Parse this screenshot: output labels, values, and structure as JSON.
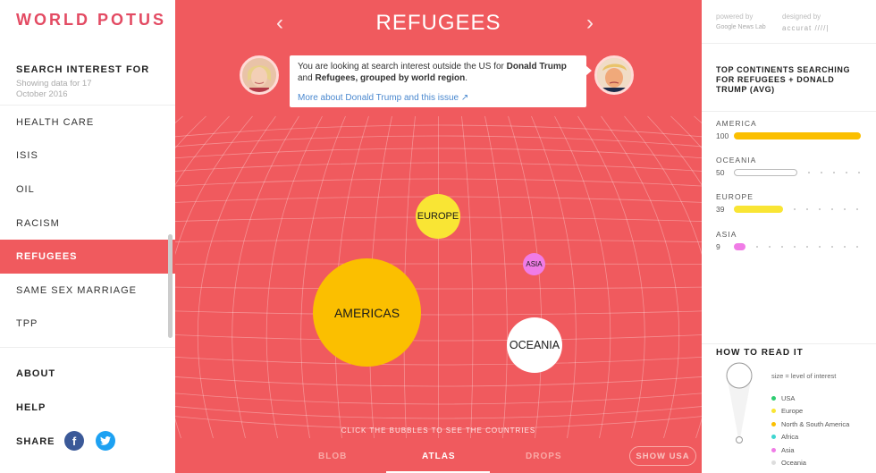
{
  "app": {
    "logo": "WORLD POTUS"
  },
  "sidebar": {
    "search_title": "SEARCH INTEREST FOR",
    "showing": "Showing data for 17 October 2016",
    "topics": [
      "HEALTH CARE",
      "ISIS",
      "OIL",
      "RACISM",
      "REFUGEES",
      "SAME SEX MARRIAGE",
      "TPP"
    ],
    "active_topic": "REFUGEES",
    "about": "ABOUT",
    "help": "HELP",
    "share": "SHARE",
    "share_icons": [
      "facebook-icon",
      "twitter-icon"
    ]
  },
  "main": {
    "title": "REFUGEES",
    "prev_icon": "chevron-left-icon",
    "next_icon": "chevron-right-icon",
    "callout": {
      "text_before": "You are looking at search interest outside the US for ",
      "candidate": "Donald Trump",
      "text_and": " and ",
      "topic": "Refugees, grouped by world region",
      "text_end": ".",
      "more_link": "More about Donald Trump and this issue",
      "link_icon": "external-link-icon"
    },
    "bubbles": [
      {
        "label": "EUROPE",
        "color": "#f9e534"
      },
      {
        "label": "ASIA",
        "color": "#f07ce6"
      },
      {
        "label": "AMERICAS",
        "color": "#fbbf00"
      },
      {
        "label": "OCEANIA",
        "color": "#ffffff"
      }
    ],
    "hint": "CLICK THE BUBBLES TO SEE THE COUNTRIES",
    "tabs": [
      "BLOB",
      "ATLAS",
      "DROPS"
    ],
    "active_tab": "ATLAS",
    "show_usa": "SHOW USA",
    "background_color": "#f05a5e"
  },
  "right": {
    "powered_label": "powered by",
    "powered_by": "Google News Lab",
    "designed_label": "designed by",
    "designed_by": "accurat ////|",
    "top_title": "TOP CONTINENTS SEARCHING FOR REFUGEES + DONALD TRUMP (AVG)",
    "continents": [
      {
        "name": "AMERICA",
        "value": 100,
        "color": "#fbbf00"
      },
      {
        "name": "OCEANIA",
        "value": 50,
        "color": "#ffffff"
      },
      {
        "name": "EUROPE",
        "value": 39,
        "color": "#f9e534"
      },
      {
        "name": "ASIA",
        "value": 9,
        "color": "#f07ce6"
      }
    ],
    "how_to_read": "HOW TO READ IT",
    "size_note": "size = level of interest",
    "legend": [
      {
        "label": "USA",
        "color": "#2ecc71"
      },
      {
        "label": "Europe",
        "color": "#f9e534"
      },
      {
        "label": "North & South America",
        "color": "#fbbf00"
      },
      {
        "label": "Africa",
        "color": "#3fd6d0"
      },
      {
        "label": "Asia",
        "color": "#f07ce6"
      },
      {
        "label": "Oceania",
        "color": "#dddddd"
      }
    ]
  }
}
